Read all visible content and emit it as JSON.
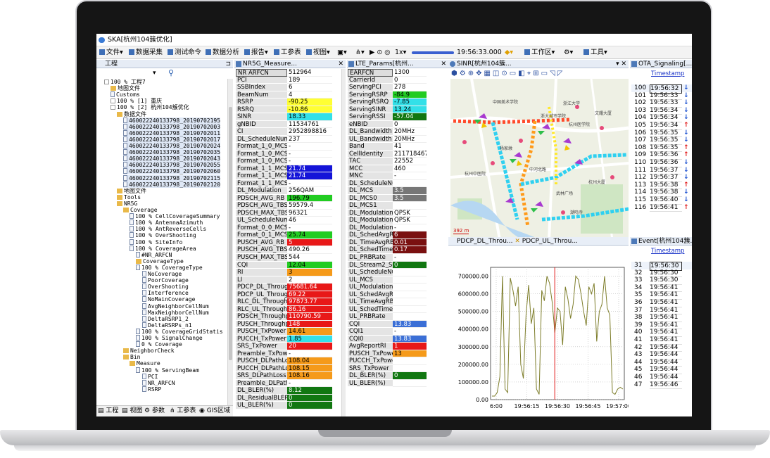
{
  "app": {
    "title": "SKA[杭州104簇优化]",
    "menu": [
      "文件",
      "数据采集",
      "测试命令",
      "数据分析",
      "报告",
      "工参表",
      "视图",
      "1x",
      "工作区",
      "工具"
    ],
    "time": "19:56:33.000"
  },
  "tree": {
    "title": "工程",
    "rows": [
      "100 % 工程7",
      "地图文件",
      "Customs",
      "100 % [1] 重庆",
      "100 % [2] 杭州104簇优化",
      "数据文件",
      "460022240133798_20190702195",
      "460022240133798_20190702003",
      "460022240133798_20190702011",
      "460022240133798_20190702017",
      "460022240133798_20190702024",
      "460022240133798_20190702035",
      "460022240133798_20190702043",
      "460022240133798_20190702055",
      "460022240133798_20190702060",
      "460022240133798_20190702115",
      "460022240133798_20190702120",
      "地图文件",
      "Tools",
      "NR5G",
      "Coverage",
      "100 % CellCoverageSummary",
      "100 % AntennaAzimuth",
      "100 % AntReverseCells",
      "100 % OverShooting",
      "100 % SiteInfo",
      "100 % CoverageArea",
      "#NR_ARFCN",
      "CoverageType",
      "100 % CoverageType",
      "NoCoverage",
      "PoorCoverage",
      "OverShooting",
      "Interference",
      "NoMainCoverage",
      "AvgNeighborCellNum",
      "MaxNeighborCellNum",
      "DeltaRSRP1_2",
      "DeltaRSRPs_n1",
      "100 % CoverageGridStatis",
      "100 % SignalChange",
      "0 % Coverage",
      "NeighborCheck",
      "Bin",
      "Measure",
      "100 % ServingBeam",
      "PCI",
      "NR_ARFCN",
      "RSRP"
    ],
    "tabs": [
      "工程",
      "视图",
      "参数",
      "工参表",
      "GIS区域"
    ]
  },
  "nr5g": {
    "title": "NR5G_Measure...",
    "rows": [
      [
        "NR ARFCN",
        "512964",
        ""
      ],
      [
        "PCI",
        "189",
        ""
      ],
      [
        "SSBIndex",
        "6",
        ""
      ],
      [
        "BeamNum",
        "4",
        ""
      ],
      [
        "RSRP",
        "-90.25",
        "#ffff33"
      ],
      [
        "RSRQ",
        "-10.86",
        "#ffff33"
      ],
      [
        "SINR",
        "18.33",
        "#33e0e8"
      ],
      [
        "gNBID",
        "11534761",
        ""
      ],
      [
        "CI",
        "2952898816",
        ""
      ],
      [
        "DL_ScheduleNum",
        "237",
        ""
      ],
      [
        "Format_1_0_MCS",
        "-",
        ""
      ],
      [
        "Format_1_0_MCS",
        "-",
        ""
      ],
      [
        "Format_1_0_MCS",
        "-",
        ""
      ],
      [
        "Format_1_1_MCS",
        "21.74",
        "#1414d8"
      ],
      [
        "Format_1_1_MCS",
        "21.74",
        "#1414d8"
      ],
      [
        "Format_1_1_MCS",
        "-",
        ""
      ],
      [
        "DL_Modulation",
        "256QAM",
        ""
      ],
      [
        "PDSCH_AVG_RB",
        "196.79",
        "#22cc22"
      ],
      [
        "PDSCH_AVG_TBS",
        "59579.4",
        ""
      ],
      [
        "PDSCH_MAX_TBS",
        "96321",
        ""
      ],
      [
        "UL_ScheduleNum",
        "46",
        ""
      ],
      [
        "Format_0_0_MCS",
        "-",
        ""
      ],
      [
        "Format_0_1_MCS",
        "25.74",
        "#22cc22"
      ],
      [
        "PUSCH_AVG_RB",
        "5",
        "#e81818"
      ],
      [
        "PUSCH_AVG_TBS",
        "490.26",
        ""
      ],
      [
        "PUSCH_MAX_TBS",
        "544",
        ""
      ],
      [
        "CQI",
        "12.04",
        "#22cc22"
      ],
      [
        "RI",
        "3",
        "#f59a1a"
      ],
      [
        "LI",
        "2",
        ""
      ],
      [
        "PDCP_DL_Throughput",
        "75681.64",
        "#e81818"
      ],
      [
        "PDCP_UL_Throughput",
        "69.22",
        "#e81818"
      ],
      [
        "RLC_DL_Throughput",
        "97873.77",
        "#e81818"
      ],
      [
        "RLC_UL_Throughput",
        "86.16",
        "#e81818"
      ],
      [
        "PDSCH_Throughput",
        "110790.59",
        "#e81818"
      ],
      [
        "PUSCH_Throughput",
        "148",
        "#e81818"
      ],
      [
        "PUSCH_TxPower",
        "14.61",
        "#f59a1a"
      ],
      [
        "PUCCH_TxPower",
        "1.85",
        "#33e0e8"
      ],
      [
        "SRS_TxPower",
        "20",
        "#e81818"
      ],
      [
        "Preamble_TxPower",
        "-",
        ""
      ],
      [
        "PUSCH_DLPathLoss",
        "108.04",
        "#f59a1a"
      ],
      [
        "PUCCH_DLPathLoss",
        "108.15",
        "#f59a1a"
      ],
      [
        "SRS_DLPathLoss",
        "108.16",
        "#f59a1a"
      ],
      [
        "Preamble_DLPathLoss",
        "-",
        ""
      ],
      [
        "DL_BLER(%)",
        "8.12",
        "#117711"
      ],
      [
        "DL_ResidualBLER",
        "0",
        "#117711"
      ],
      [
        "UL_BLER(%)",
        "0",
        "#117711"
      ]
    ]
  },
  "lte": {
    "title": "LTE_Params[杭州...",
    "rows": [
      [
        "EARFCN",
        "1300",
        ""
      ],
      [
        "CarrierId",
        "0",
        ""
      ],
      [
        "ServingPCI",
        "278",
        ""
      ],
      [
        "ServingRSRP",
        "-84.9",
        "#22cc22"
      ],
      [
        "ServingRSRQ",
        "-7.85",
        "#33e0e8"
      ],
      [
        "ServingSINR",
        "13.24",
        "#33e0e8"
      ],
      [
        "ServingRSSI",
        "-57.04",
        "#117711"
      ],
      [
        "eNBID",
        "0",
        ""
      ],
      [
        "DL_Bandwidth",
        "20MHz",
        ""
      ],
      [
        "UL_Bandwidth",
        "20MHz",
        ""
      ],
      [
        "Band",
        "41",
        ""
      ],
      [
        "CellIdentity",
        "211718467",
        ""
      ],
      [
        "TAC",
        "22552",
        ""
      ],
      [
        "MCC",
        "460",
        ""
      ],
      [
        "MNC",
        "-",
        ""
      ],
      [
        "DL_ScheduleNum",
        "",
        ""
      ],
      [
        "DL_MCS",
        "3.5",
        "#777777"
      ],
      [
        "DL_MCS0",
        "3.5",
        "#777777"
      ],
      [
        "DL_MCS1",
        "",
        ""
      ],
      [
        "DL_Modulation",
        "QPSK",
        ""
      ],
      [
        "DL_Modulation",
        "QPSK",
        ""
      ],
      [
        "DL_Modulation",
        "-",
        ""
      ],
      [
        "DL_SchedAvgRB",
        "6",
        "#7a1010"
      ],
      [
        "DL_TimeAvgRB",
        "0.01",
        "#7a1010"
      ],
      [
        "DL_SchedTime",
        "0.17",
        "#7a1010"
      ],
      [
        "DL_PRBRate",
        "-",
        ""
      ],
      [
        "DL_Stream2_Sch",
        "0",
        "#117711"
      ],
      [
        "UL_ScheduleNum",
        "",
        ""
      ],
      [
        "UL_MCS",
        "",
        ""
      ],
      [
        "UL_Modulation",
        "",
        ""
      ],
      [
        "UL_SchedAvgRB",
        "",
        ""
      ],
      [
        "UL_TimeAvgRB",
        "",
        ""
      ],
      [
        "UL_SchedTime",
        "",
        ""
      ],
      [
        "UL_PRBRate",
        "",
        ""
      ],
      [
        "CQI",
        "13.83",
        "#3b6fd6"
      ],
      [
        "CQI1",
        "-",
        ""
      ],
      [
        "CQI0",
        "13.83",
        "#3b6fd6"
      ],
      [
        "AvgReportRI",
        "1",
        "#e81818"
      ],
      [
        "PUSCH_TxPower",
        "13",
        "#f59a1a"
      ],
      [
        "PUCCH_TxPower",
        "",
        ""
      ],
      [
        "SRS_TxPower",
        "",
        ""
      ],
      [
        "DL_BLER(%)",
        "0",
        "#117711"
      ],
      [
        "UL_BLER(%)",
        "",
        ""
      ]
    ]
  },
  "gis": {
    "title": "SINR[杭州104簇...",
    "scale": "392 m",
    "labels": [
      "中国美术学院",
      "浙大城市学院",
      "杨家墩",
      "浙江大学",
      "杭州大厦",
      "文耀大厦",
      "杭州医学院",
      "杭州中医院",
      "武林广场",
      "潮鸣寺",
      "中河北路"
    ]
  },
  "chart_tabs": [
    "PDCP_DL_Throu...",
    "PDCP_UL_Throu..."
  ],
  "chart_data": {
    "type": "line",
    "series": [
      {
        "values": [
          20000,
          20000,
          40000,
          130000,
          700000,
          60000,
          40000,
          690000,
          620000,
          530000,
          640000,
          200000,
          120000,
          480000,
          650000,
          430000,
          520000,
          60000,
          30000,
          620000,
          560000,
          700000,
          660000,
          550000,
          380000,
          520000,
          500000,
          310000,
          640000,
          570000,
          460000,
          540000,
          700000,
          680000,
          600000,
          500000,
          420000,
          640000,
          600000,
          660000,
          330000,
          500000,
          540000,
          700000,
          520000,
          480000,
          40000,
          30000,
          60000,
          70000,
          60000
        ]
      }
    ],
    "xlabels": [
      "6:00",
      "19:56:15",
      "19:56:30",
      "19:56:45",
      "19:57:00"
    ],
    "ylabels": [
      "700000.00",
      "600000.00",
      "500000.00",
      "400000.00",
      "300000.00",
      "200000.00",
      "100000.00",
      "0.00"
    ],
    "ylim": [
      0,
      750000
    ],
    "cursor_x_fraction": 0.48
  },
  "ota": {
    "title": "OTA_Signaling[...",
    "header": "Timestamp",
    "rows": [
      [
        "100",
        "19:56:32",
        "down"
      ],
      [
        "101",
        "19:56:33",
        "down"
      ],
      [
        "102",
        "19:56:33",
        "down"
      ],
      [
        "103",
        "19:56:34",
        "down"
      ],
      [
        "104",
        "19:56:34",
        "down"
      ],
      [
        "105",
        "19:56:34",
        "up"
      ],
      [
        "106",
        "19:56:35",
        "down"
      ],
      [
        "107",
        "19:56:35",
        "down"
      ],
      [
        "108",
        "19:56:35",
        "up"
      ],
      [
        "109",
        "19:56:36",
        "up"
      ],
      [
        "110",
        "19:56:36",
        "down"
      ],
      [
        "111",
        "19:56:37",
        "down"
      ],
      [
        "112",
        "19:56:37",
        "down"
      ],
      [
        "113",
        "19:56:38",
        "up"
      ],
      [
        "114",
        "19:56:38",
        "down"
      ],
      [
        "115",
        "19:56:40",
        "down"
      ],
      [
        "116",
        "19:56:41",
        "up"
      ]
    ]
  },
  "event": {
    "title": "Event[杭州104簇...",
    "header": "Timestamp",
    "rows": [
      [
        "31",
        "19:56:30"
      ],
      [
        "32",
        "19:56:30"
      ],
      [
        "33",
        "19:56:30"
      ],
      [
        "34",
        "19:56:41"
      ],
      [
        "35",
        "19:56:41"
      ],
      [
        "36",
        "19:56:41"
      ],
      [
        "37",
        "19:56:41"
      ],
      [
        "38",
        "19:56:41"
      ],
      [
        "39",
        "19:56:41"
      ],
      [
        "40",
        "19:56:41"
      ],
      [
        "41",
        "19:56:41"
      ],
      [
        "42",
        "19:56:44"
      ],
      [
        "43",
        "19:56:44"
      ],
      [
        "44",
        "19:56:44"
      ],
      [
        "45",
        "19:56:44"
      ],
      [
        "46",
        "19:56:44"
      ],
      [
        "47",
        "19:56:46"
      ]
    ]
  }
}
